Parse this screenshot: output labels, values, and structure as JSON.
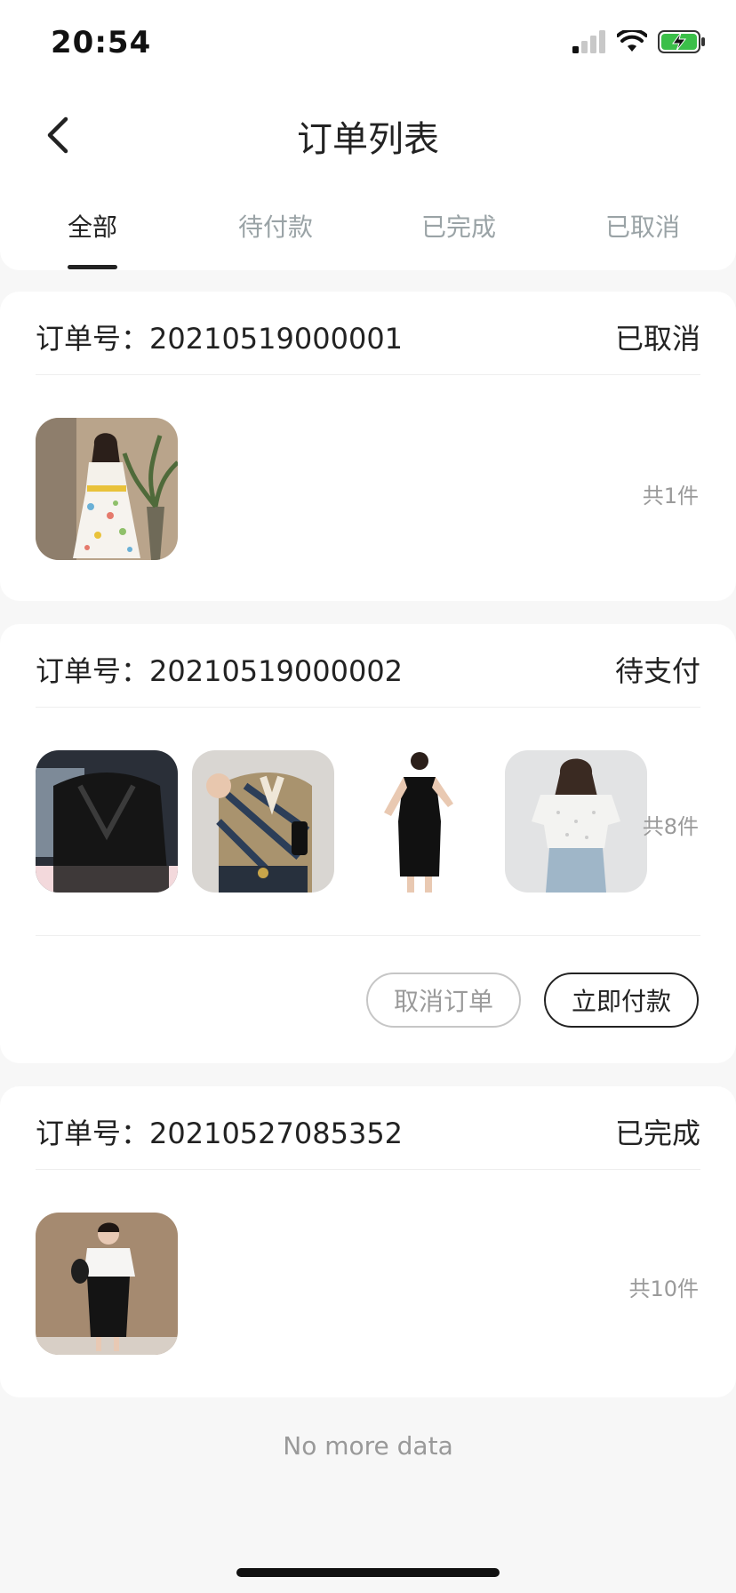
{
  "status_bar": {
    "time": "20:54"
  },
  "header": {
    "title": "订单列表"
  },
  "tabs": [
    {
      "label": "全部",
      "active": true
    },
    {
      "label": "待付款",
      "active": false
    },
    {
      "label": "已完成",
      "active": false
    },
    {
      "label": "已取消",
      "active": false
    }
  ],
  "orders": [
    {
      "label": "订单号：20210519000001",
      "status": "已取消",
      "count": "共1件"
    },
    {
      "label": "订单号：20210519000002",
      "status": "待支付",
      "count": "共8件",
      "actions": {
        "cancel": "取消订单",
        "pay": "立即付款"
      }
    },
    {
      "label": "订单号：20210527085352",
      "status": "已完成",
      "count": "共10件"
    }
  ],
  "footer": {
    "no_more": "No more data"
  },
  "colors": {
    "inactive_tab": "#9aa3a6",
    "battery": "#3bbf49",
    "muted": "#9a9a9a"
  }
}
